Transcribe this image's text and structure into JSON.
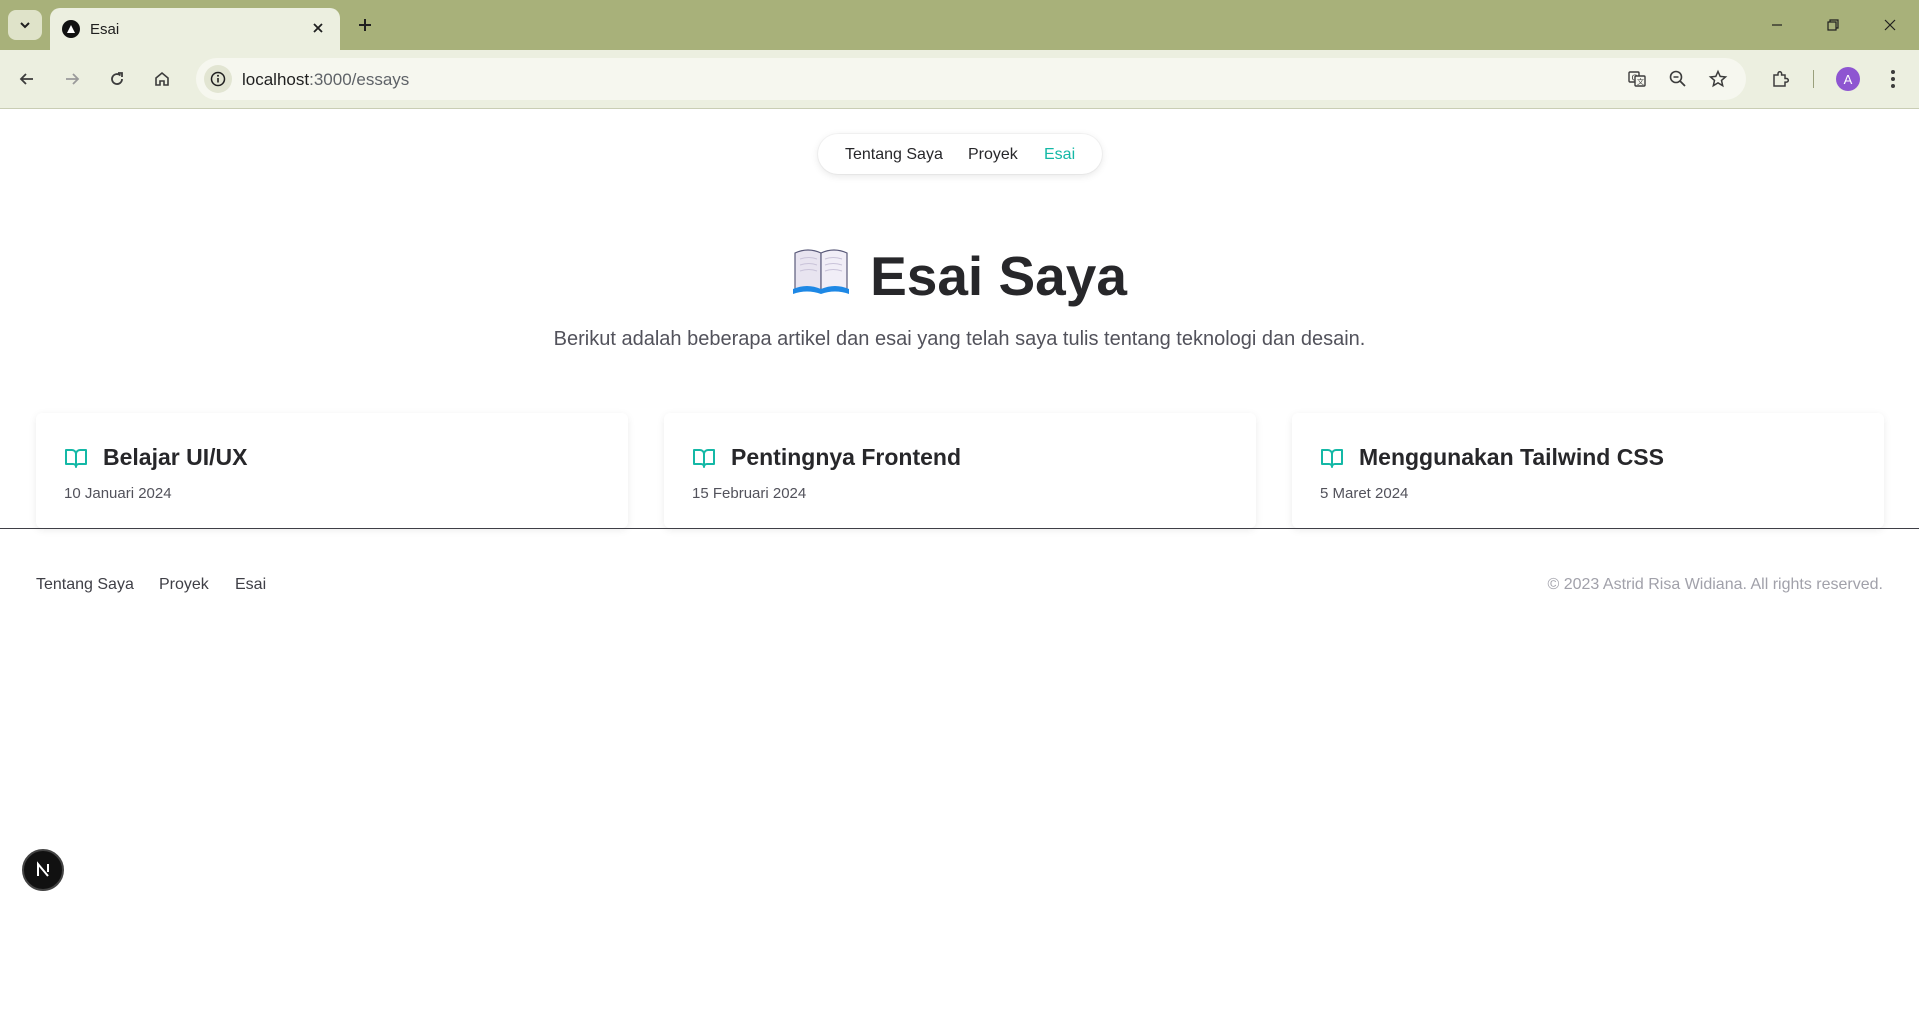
{
  "browser": {
    "tab": {
      "title": "Esai",
      "favicon": "triangle-logo-icon"
    },
    "url": {
      "host": "localhost",
      "path": ":3000/essays"
    },
    "avatar_letter": "A",
    "colors": {
      "chrome": "#a8b17a",
      "toolbar": "#ecefe0",
      "avatar": "#8e55d1"
    }
  },
  "nav": {
    "items": [
      {
        "label": "Tentang Saya",
        "active": false
      },
      {
        "label": "Proyek",
        "active": false
      },
      {
        "label": "Esai",
        "active": true
      }
    ]
  },
  "hero": {
    "emoji": "open-book-emoji",
    "title": "Esai Saya",
    "subtitle": "Berikut adalah beberapa artikel dan esai yang telah saya tulis tentang teknologi dan desain."
  },
  "essays": [
    {
      "title": "Belajar UI/UX",
      "date": "10 Januari 2024",
      "icon": "book-open-icon"
    },
    {
      "title": "Pentingnya Frontend",
      "date": "15 Februari 2024",
      "icon": "book-open-icon"
    },
    {
      "title": "Menggunakan Tailwind CSS",
      "date": "5 Maret 2024",
      "icon": "book-open-icon"
    }
  ],
  "footer": {
    "links": [
      {
        "label": "Tentang Saya"
      },
      {
        "label": "Proyek"
      },
      {
        "label": "Esai"
      }
    ],
    "copyright": "© 2023 Astrid Risa Widiana. All rights reserved."
  },
  "accent_color": "#14b8a6",
  "dev_badge": {
    "letter": "N",
    "icon": "nextjs-logo-icon"
  }
}
